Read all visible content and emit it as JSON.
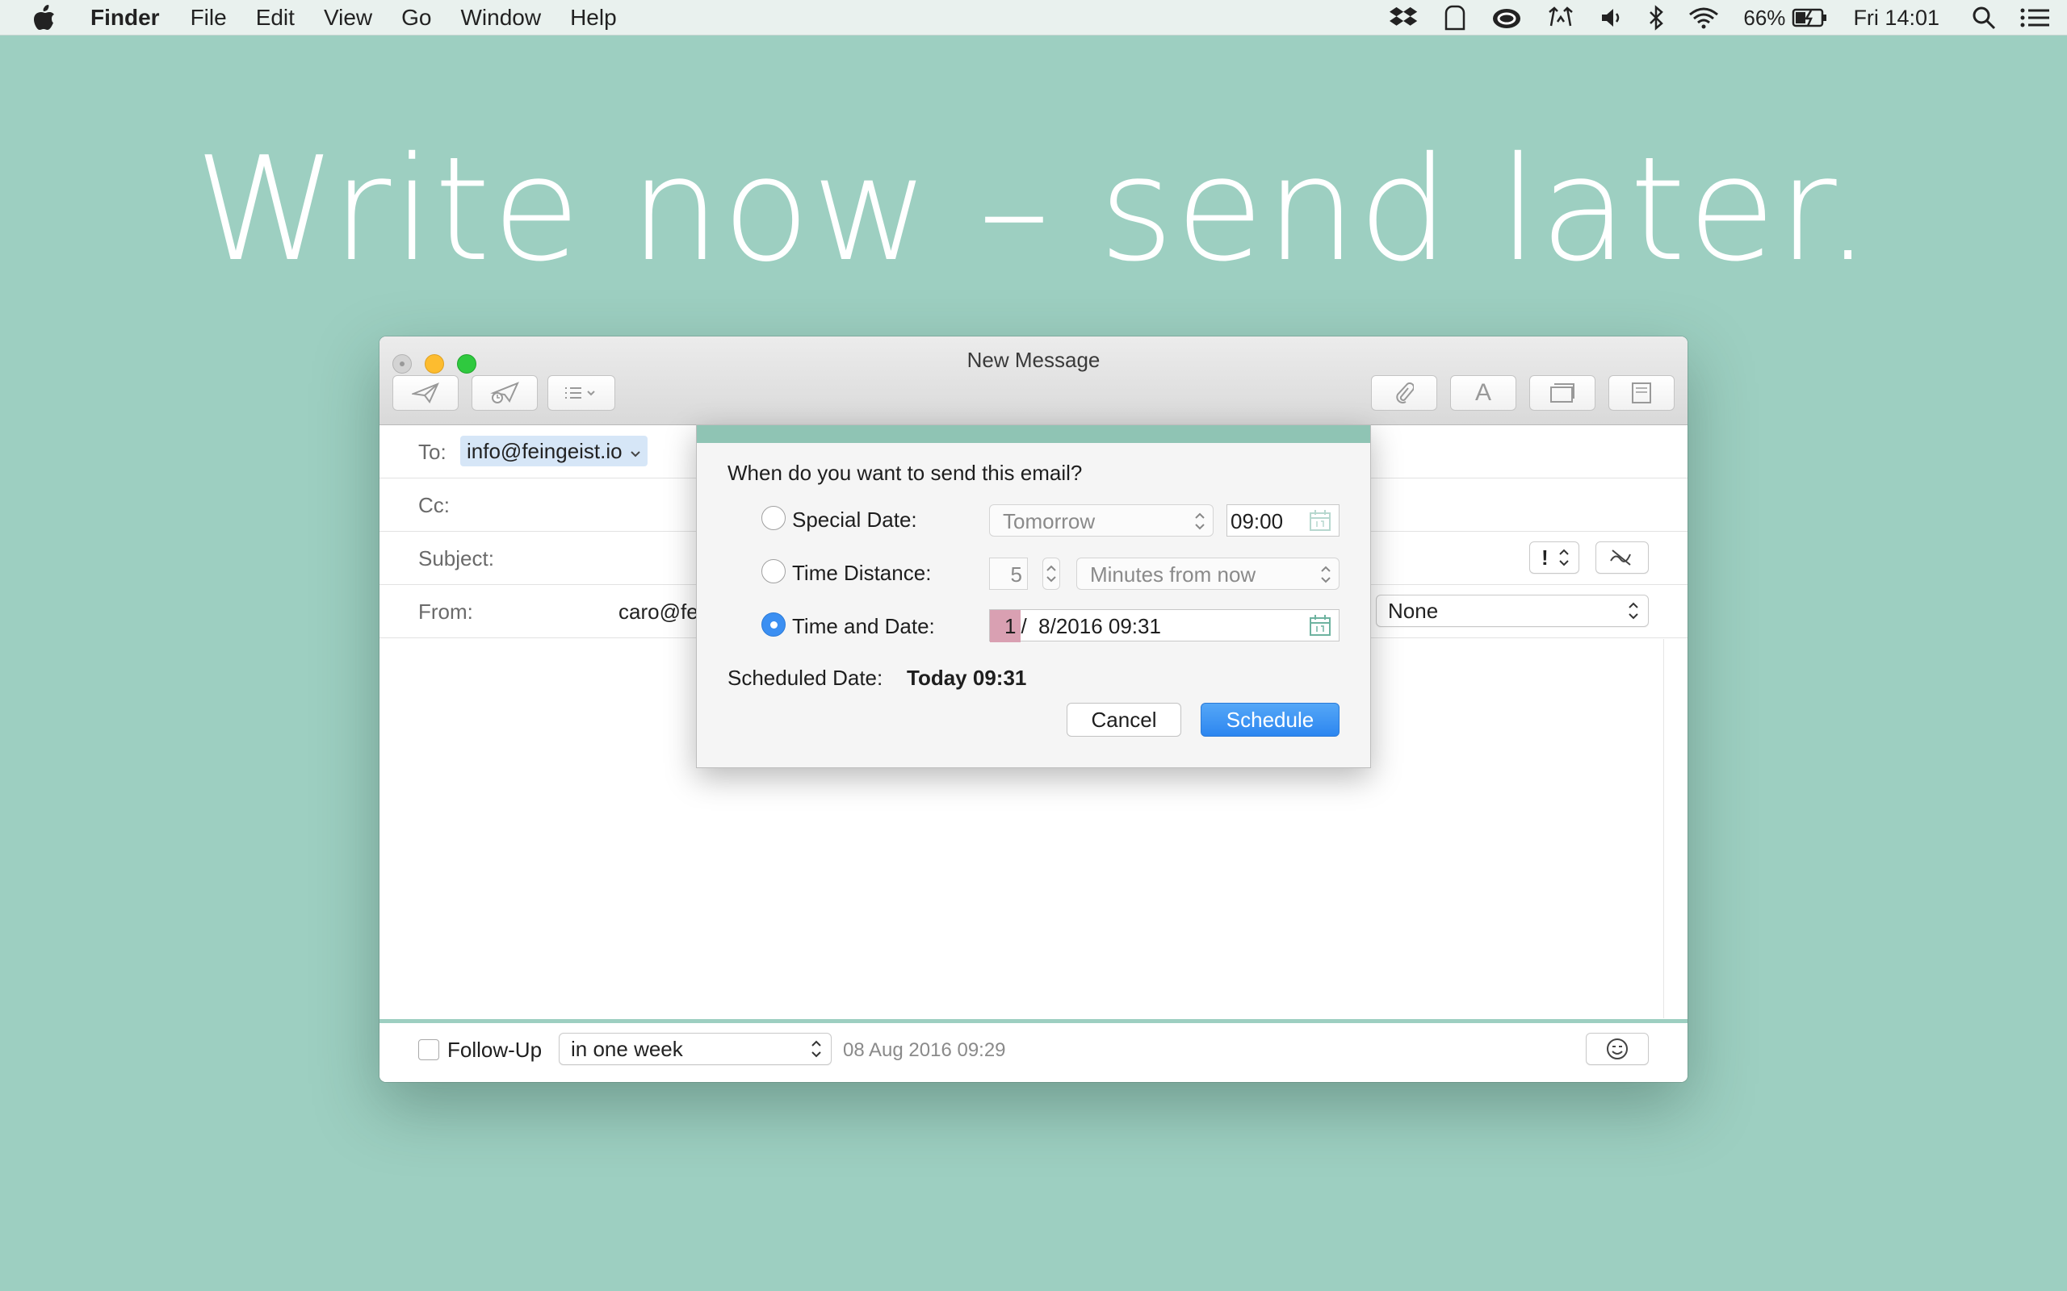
{
  "menubar": {
    "app_name": "Finder",
    "items": [
      "File",
      "Edit",
      "View",
      "Go",
      "Window",
      "Help"
    ],
    "battery_percent": "66%",
    "clock": "Fri 14:01"
  },
  "hero": {
    "headline": "Write now – send later."
  },
  "window": {
    "title": "New Message",
    "to_label": "To:",
    "to_value": "info@feingeist.io",
    "cc_label": "Cc:",
    "subject_label": "Subject:",
    "from_label": "From:",
    "from_value": "caro@fe",
    "priority_value": "!",
    "signature_value": "None",
    "footer": {
      "followup_label": "Follow-Up",
      "followup_checked": false,
      "followup_value": "in one week",
      "timestamp": "08 Aug 2016 09:29"
    }
  },
  "dialog": {
    "question": "When do you want to send this email?",
    "options": [
      {
        "label": "Special Date:",
        "selected": false
      },
      {
        "label": "Time Distance:",
        "selected": false
      },
      {
        "label": "Time and Date:",
        "selected": true
      }
    ],
    "special_date_value": "Tomorrow",
    "special_time_value": "09:00",
    "distance_number": "5",
    "distance_unit": "Minutes from now",
    "date_day_segment": "1",
    "date_rest": "/  8/2016 09:31",
    "scheduled_label": "Scheduled Date:",
    "scheduled_value": "Today 09:31",
    "cancel_label": "Cancel",
    "schedule_label": "Schedule"
  },
  "colors": {
    "background": "#9dcfc1",
    "accent": "#3b8ff2",
    "date_highlight": "#d9a0b2"
  }
}
